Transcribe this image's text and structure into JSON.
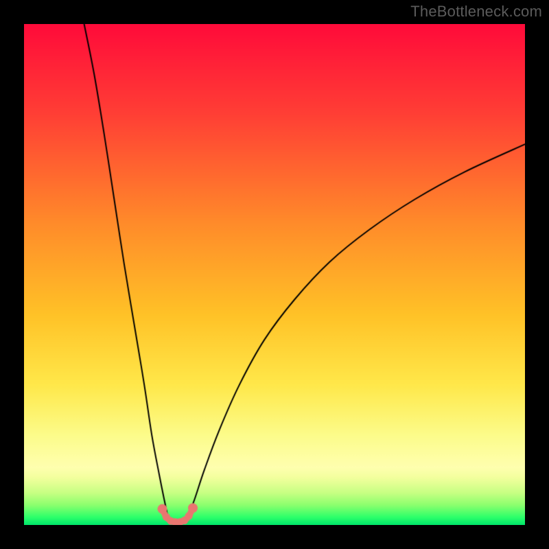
{
  "watermark": {
    "text": "TheBottleneck.com"
  },
  "chart_data": {
    "type": "line",
    "title": "",
    "xlabel": "",
    "ylabel": "",
    "xlim": [
      0,
      100
    ],
    "ylim": [
      0,
      100
    ],
    "grid": false,
    "legend_position": "none",
    "gradient_stops": [
      {
        "t": 0.0,
        "color": "#ff0b3a"
      },
      {
        "t": 0.18,
        "color": "#ff3f35"
      },
      {
        "t": 0.4,
        "color": "#ff8c2a"
      },
      {
        "t": 0.58,
        "color": "#ffc227"
      },
      {
        "t": 0.72,
        "color": "#ffe84a"
      },
      {
        "t": 0.82,
        "color": "#fcfc8a"
      },
      {
        "t": 0.885,
        "color": "#ffffaf"
      },
      {
        "t": 0.905,
        "color": "#f3ff9e"
      },
      {
        "t": 0.935,
        "color": "#c9ff84"
      },
      {
        "t": 0.96,
        "color": "#8dff6e"
      },
      {
        "t": 0.985,
        "color": "#2bff6a"
      },
      {
        "t": 1.0,
        "color": "#00e56a"
      }
    ],
    "series": [
      {
        "name": "left-branch",
        "color": "#000000",
        "width": 2,
        "x": [
          12.0,
          14.0,
          16.0,
          18.0,
          20.0,
          22.0,
          24.0,
          25.5,
          27.0,
          28.0,
          28.8
        ],
        "y": [
          100.0,
          90.0,
          78.0,
          65.0,
          52.0,
          40.0,
          28.0,
          18.0,
          10.0,
          5.0,
          1.2
        ]
      },
      {
        "name": "right-branch",
        "color": "#000000",
        "width": 2,
        "x": [
          32.5,
          34.0,
          36.0,
          39.0,
          43.0,
          48.0,
          54.0,
          61.0,
          69.0,
          78.0,
          88.0,
          100.0
        ],
        "y": [
          1.2,
          5.0,
          11.0,
          19.0,
          28.0,
          37.0,
          45.0,
          52.5,
          59.0,
          65.0,
          70.5,
          76.0
        ]
      },
      {
        "name": "red-u-overlay",
        "color": "#e97670",
        "width": 9,
        "style": "segmented-dots",
        "x": [
          27.6,
          28.4,
          29.3,
          30.2,
          31.1,
          32.0,
          32.9,
          33.7
        ],
        "y": [
          3.2,
          1.6,
          0.8,
          0.6,
          0.6,
          0.9,
          1.8,
          3.4
        ]
      }
    ]
  }
}
